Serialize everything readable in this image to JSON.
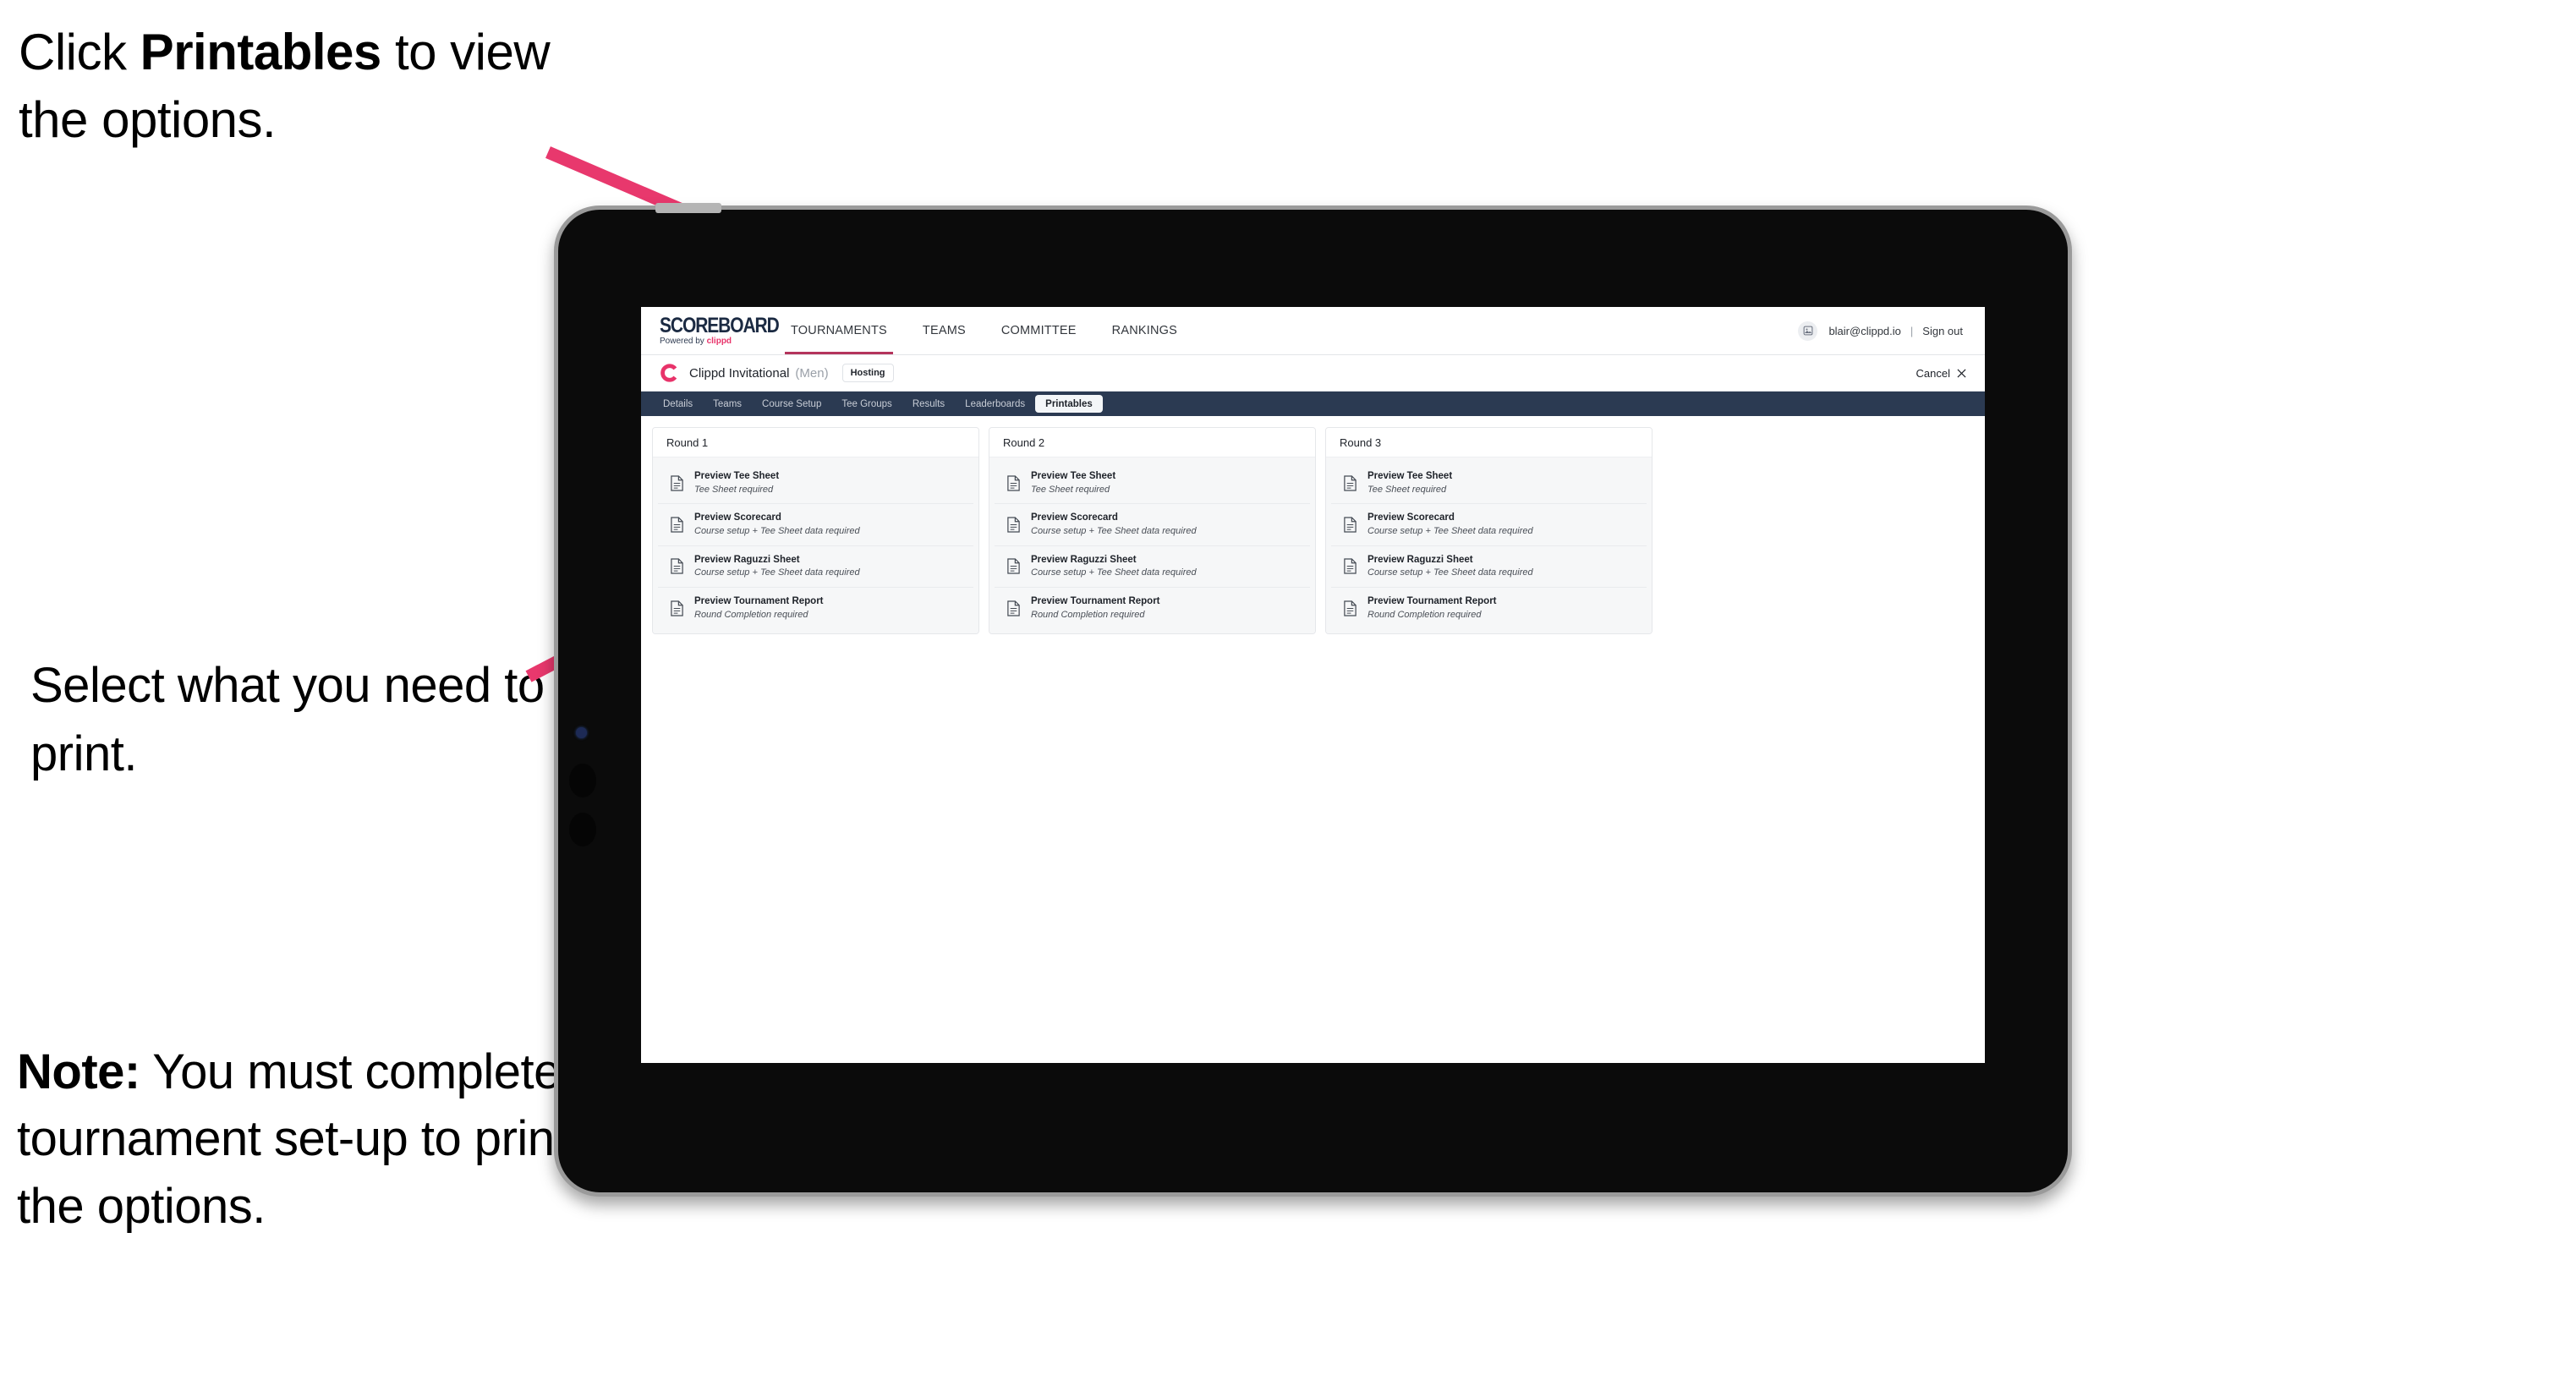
{
  "annotations": {
    "top": {
      "pre": "Click ",
      "bold": "Printables",
      "post": " to view the options."
    },
    "middle": {
      "text": "Select what you need to print."
    },
    "note": {
      "bold": "Note:",
      "text": " You must complete the tournament set-up to print all the options."
    }
  },
  "accent_color": "#e8336a",
  "navbar_color": "#2b3a52",
  "browser": {
    "logo": {
      "word": "SCOREBOARD",
      "powered_prefix": "Powered by ",
      "brand": "clippd"
    },
    "nav_items": [
      {
        "label": "TOURNAMENTS",
        "active": true
      },
      {
        "label": "TEAMS",
        "active": false
      },
      {
        "label": "COMMITTEE",
        "active": false
      },
      {
        "label": "RANKINGS",
        "active": false
      }
    ],
    "user": {
      "email": "blair@clippd.io",
      "separator": "|",
      "sign_out": "Sign out",
      "avatar_icon": "user-avatar-icon"
    }
  },
  "event": {
    "logo_letter": "C",
    "name": "Clippd Invitational",
    "gender": "(Men)",
    "status_chip": "Hosting",
    "cancel_label": "Cancel",
    "cancel_icon": "close-icon"
  },
  "tabs": [
    {
      "label": "Details",
      "active": false
    },
    {
      "label": "Teams",
      "active": false
    },
    {
      "label": "Course Setup",
      "active": false
    },
    {
      "label": "Tee Groups",
      "active": false
    },
    {
      "label": "Results",
      "active": false
    },
    {
      "label": "Leaderboards",
      "active": false
    },
    {
      "label": "Printables",
      "active": true
    }
  ],
  "rounds": [
    {
      "title": "Round 1",
      "items": [
        {
          "title": "Preview Tee Sheet",
          "sub": "Tee Sheet required",
          "icon": "document-icon"
        },
        {
          "title": "Preview Scorecard",
          "sub": "Course setup + Tee Sheet data required",
          "icon": "document-icon"
        },
        {
          "title": "Preview Raguzzi Sheet",
          "sub": "Course setup + Tee Sheet data required",
          "icon": "document-icon"
        },
        {
          "title": "Preview Tournament Report",
          "sub": "Round Completion required",
          "icon": "document-icon"
        }
      ]
    },
    {
      "title": "Round 2",
      "items": [
        {
          "title": "Preview Tee Sheet",
          "sub": "Tee Sheet required",
          "icon": "document-icon"
        },
        {
          "title": "Preview Scorecard",
          "sub": "Course setup + Tee Sheet data required",
          "icon": "document-icon"
        },
        {
          "title": "Preview Raguzzi Sheet",
          "sub": "Course setup + Tee Sheet data required",
          "icon": "document-icon"
        },
        {
          "title": "Preview Tournament Report",
          "sub": "Round Completion required",
          "icon": "document-icon"
        }
      ]
    },
    {
      "title": "Round 3",
      "items": [
        {
          "title": "Preview Tee Sheet",
          "sub": "Tee Sheet required",
          "icon": "document-icon"
        },
        {
          "title": "Preview Scorecard",
          "sub": "Course setup + Tee Sheet data required",
          "icon": "document-icon"
        },
        {
          "title": "Preview Raguzzi Sheet",
          "sub": "Course setup + Tee Sheet data required",
          "icon": "document-icon"
        },
        {
          "title": "Preview Tournament Report",
          "sub": "Round Completion required",
          "icon": "document-icon"
        }
      ]
    }
  ]
}
